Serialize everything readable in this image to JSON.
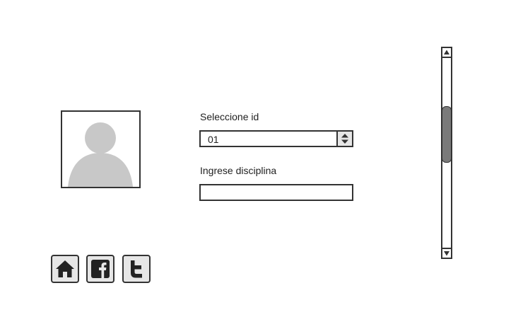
{
  "form": {
    "id_label": "Seleccione id",
    "id_value": "01",
    "discipline_label": "Ingrese disciplina",
    "discipline_value": "",
    "discipline_placeholder": ""
  },
  "icons": {
    "avatar": "user-silhouette-icon",
    "spinner": "up-down-arrows-icon",
    "scroll_up": "triangle-up-icon",
    "scroll_down": "triangle-down-icon",
    "home": "home-icon",
    "facebook": "facebook-icon",
    "twitter": "twitter-icon"
  },
  "scrollbar": {
    "position_fraction": 0.36
  },
  "colors": {
    "border": "#333333",
    "avatar_fill": "#c8c8c8",
    "button_bg": "#e6e6e6",
    "thumb": "#7a7a7a"
  }
}
